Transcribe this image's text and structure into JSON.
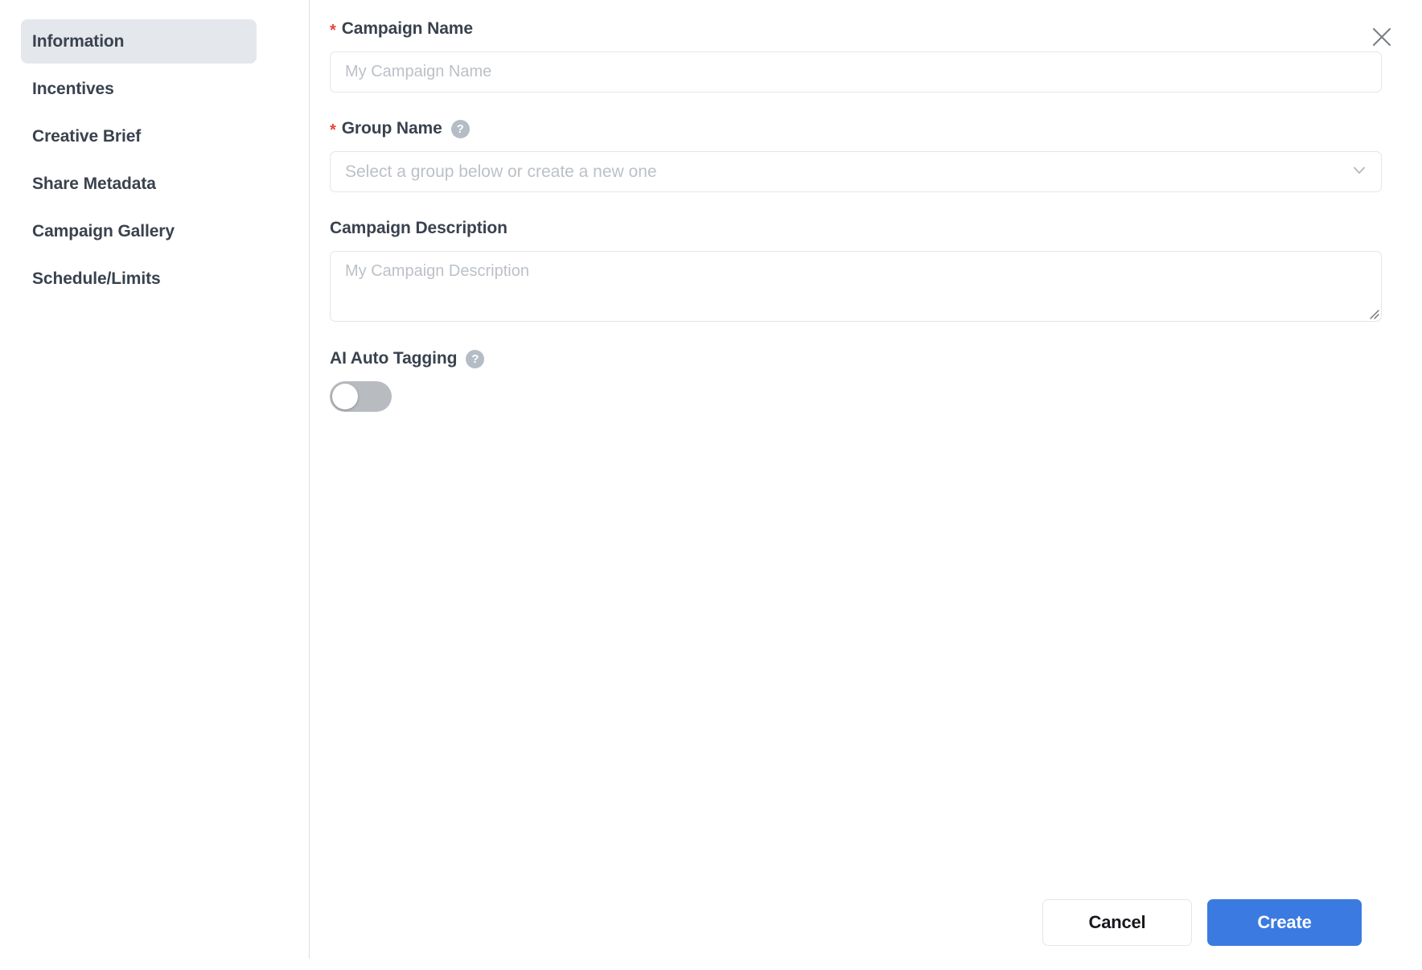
{
  "dialog": {
    "close_label": "close-icon"
  },
  "sidebar": {
    "items": [
      {
        "label": "Information",
        "active": true
      },
      {
        "label": "Incentives",
        "active": false
      },
      {
        "label": "Creative Brief",
        "active": false
      },
      {
        "label": "Share Metadata",
        "active": false
      },
      {
        "label": "Campaign Gallery",
        "active": false
      },
      {
        "label": "Schedule/Limits",
        "active": false
      }
    ]
  },
  "form": {
    "campaign_name": {
      "label": "Campaign Name",
      "required_marker": "*",
      "value": "",
      "placeholder": "My Campaign Name"
    },
    "group_name": {
      "label": "Group Name",
      "required_marker": "*",
      "help_glyph": "?",
      "value": "",
      "placeholder": "Select a group below or create a new one"
    },
    "campaign_description": {
      "label": "Campaign Description",
      "value": "",
      "placeholder": "My Campaign Description"
    },
    "ai_auto_tagging": {
      "label": "AI Auto Tagging",
      "help_glyph": "?",
      "state": "off"
    }
  },
  "footer": {
    "cancel_label": "Cancel",
    "create_label": "Create"
  },
  "colors": {
    "accent": "#3b7ae0",
    "required": "#e8453c",
    "active_nav_bg": "#e4e7eb",
    "text": "#39424e",
    "placeholder": "#bcc1c7",
    "border": "#e3e5e8",
    "toggle_off": "#b8bcc0"
  }
}
